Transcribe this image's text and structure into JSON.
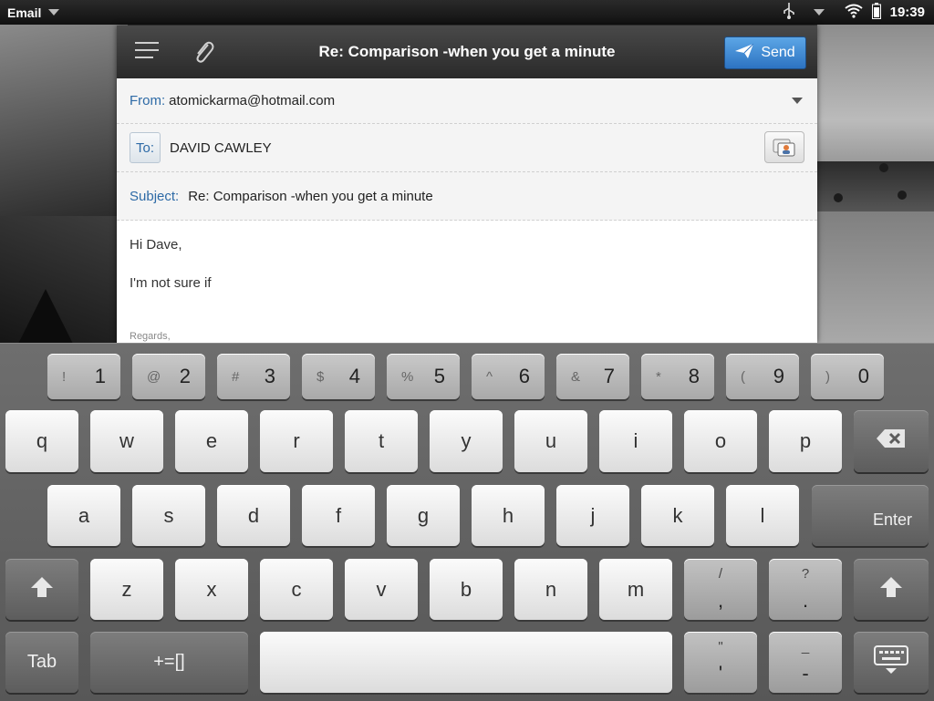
{
  "status_bar": {
    "app_name": "Email",
    "time": "19:39"
  },
  "compose": {
    "title": "Re: Comparison -when you get a minute",
    "send_label": "Send",
    "from_label": "From:",
    "from_value": "atomickarma@hotmail.com",
    "to_label": "To:",
    "to_value": "DAVID CAWLEY",
    "subject_label": "Subject:",
    "subject_value": "Re: Comparison -when you get a minute",
    "body_line1": "Hi Dave,",
    "body_line2": "I'm not sure if",
    "signature": "Regards,"
  },
  "keyboard": {
    "number_row": [
      {
        "sym": "!",
        "digit": "1"
      },
      {
        "sym": "@",
        "digit": "2"
      },
      {
        "sym": "#",
        "digit": "3"
      },
      {
        "sym": "$",
        "digit": "4"
      },
      {
        "sym": "%",
        "digit": "5"
      },
      {
        "sym": "^",
        "digit": "6"
      },
      {
        "sym": "&",
        "digit": "7"
      },
      {
        "sym": "*",
        "digit": "8"
      },
      {
        "sym": "(",
        "digit": "9"
      },
      {
        "sym": ")",
        "digit": "0"
      }
    ],
    "row1": [
      "q",
      "w",
      "e",
      "r",
      "t",
      "y",
      "u",
      "i",
      "o",
      "p"
    ],
    "row2": [
      "a",
      "s",
      "d",
      "f",
      "g",
      "h",
      "j",
      "k",
      "l"
    ],
    "row3": [
      "z",
      "x",
      "c",
      "v",
      "b",
      "n",
      "m"
    ],
    "enter_label": "Enter",
    "tab_label": "Tab",
    "symbols_label": "+=[]",
    "slash_comma": {
      "top": "/",
      "bottom": ","
    },
    "question_period": {
      "top": "?",
      "bottom": "."
    },
    "quote_apostrophe": {
      "top": "\"",
      "bottom": "'"
    },
    "underscore_dash": {
      "top": "_",
      "bottom": "-"
    }
  }
}
